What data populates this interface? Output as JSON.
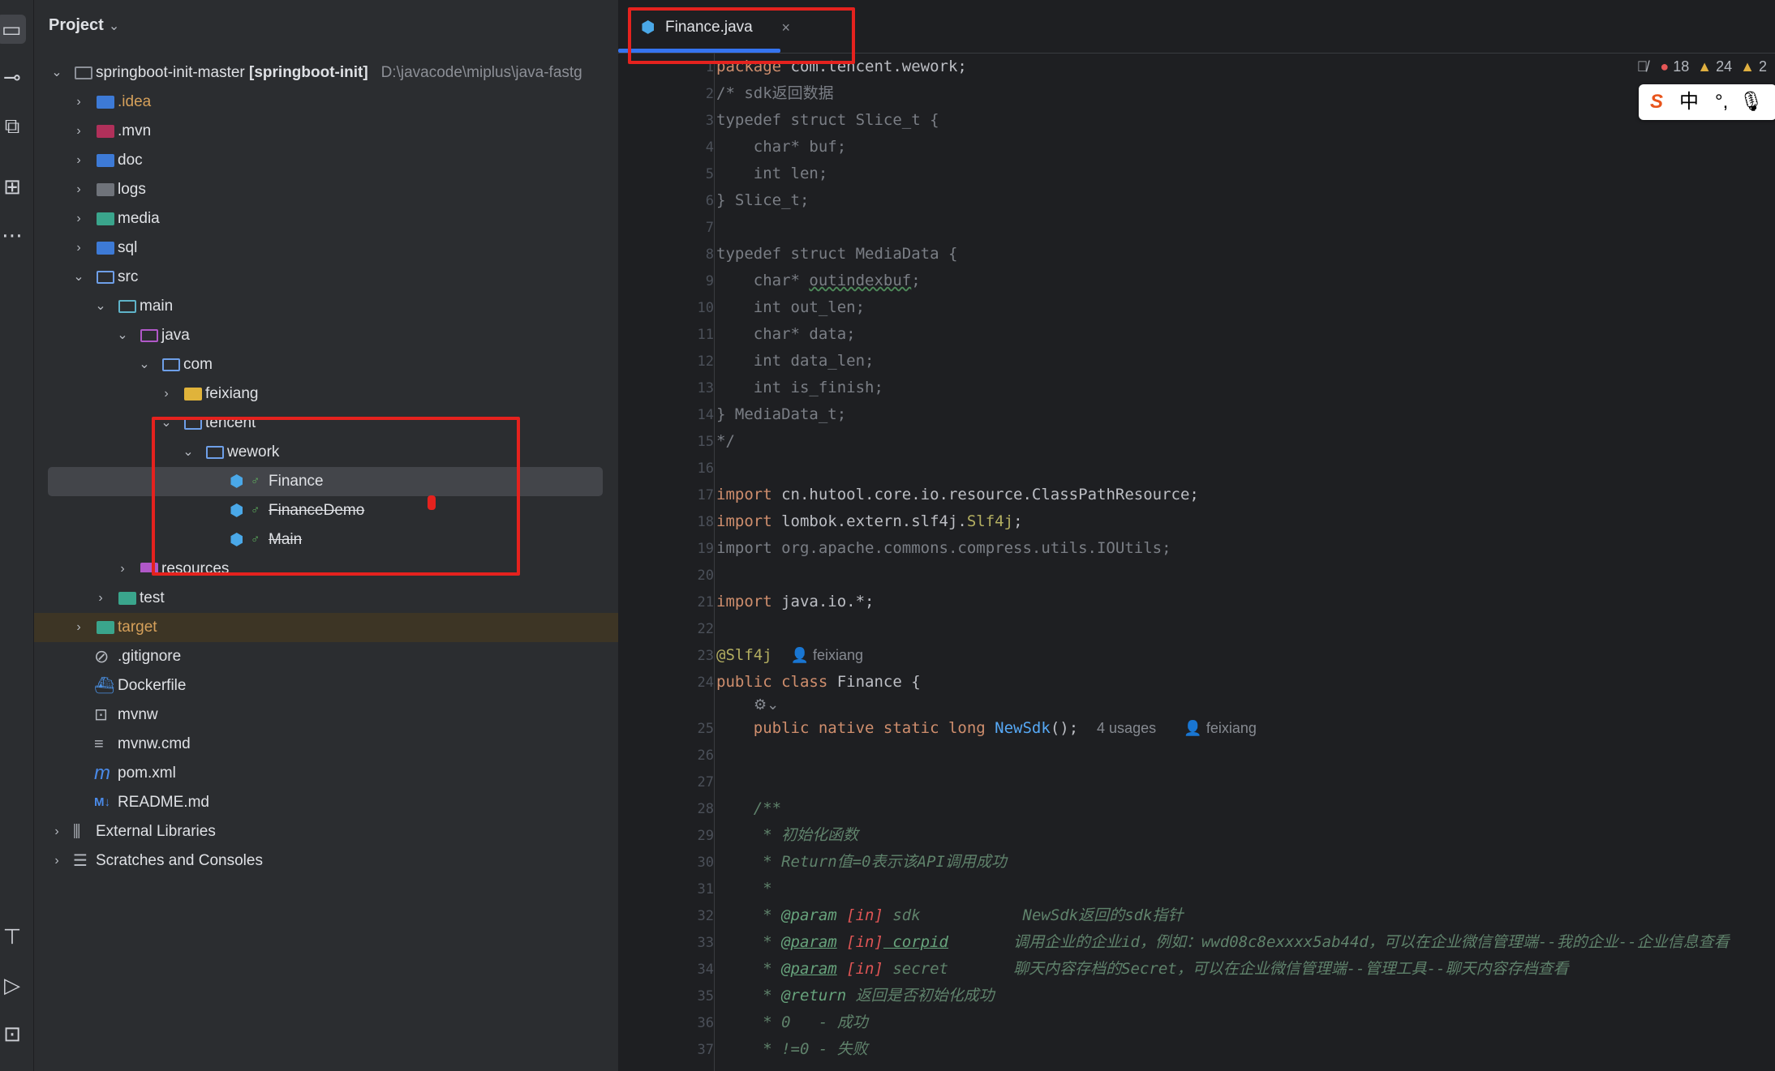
{
  "sidebar": {
    "icons": [
      "folder-icon",
      "commit-icon",
      "vcs-icon",
      "structure-icon",
      "more-icon",
      "build-icon",
      "run-icon",
      "terminal-icon"
    ]
  },
  "project": {
    "title": "Project",
    "tree": [
      {
        "label": "springboot-init-master",
        "bold": "[springboot-init]",
        "path": "D:\\javacode\\miplus\\java-fastg",
        "depth": 0,
        "open": true
      },
      {
        "label": ".idea",
        "depth": 1
      },
      {
        "label": ".mvn",
        "depth": 1
      },
      {
        "label": "doc",
        "depth": 1
      },
      {
        "label": "logs",
        "depth": 1
      },
      {
        "label": "media",
        "depth": 1
      },
      {
        "label": "sql",
        "depth": 1
      },
      {
        "label": "src",
        "depth": 1,
        "open": true
      },
      {
        "label": "main",
        "depth": 2,
        "open": true
      },
      {
        "label": "java",
        "depth": 3,
        "open": true
      },
      {
        "label": "com",
        "depth": 4,
        "open": true
      },
      {
        "label": "feixiang",
        "depth": 5
      },
      {
        "label": "tencent",
        "depth": 4,
        "open": true
      },
      {
        "label": "wework",
        "depth": 5,
        "open": true
      },
      {
        "label": "Finance",
        "depth": 6
      },
      {
        "label": "FinanceDemo",
        "depth": 6
      },
      {
        "label": "Main",
        "depth": 6
      },
      {
        "label": "resources",
        "depth": 3
      },
      {
        "label": "test",
        "depth": 2
      },
      {
        "label": "target",
        "depth": 1
      },
      {
        "label": ".gitignore",
        "depth": 1
      },
      {
        "label": "Dockerfile",
        "depth": 1
      },
      {
        "label": "mvnw",
        "depth": 1
      },
      {
        "label": "mvnw.cmd",
        "depth": 1
      },
      {
        "label": "pom.xml",
        "depth": 1
      },
      {
        "label": "README.md",
        "depth": 1
      },
      {
        "label": "External Libraries",
        "depth": 0
      },
      {
        "label": "Scratches and Consoles",
        "depth": 0
      }
    ]
  },
  "editor": {
    "tab": {
      "label": "Finance.java",
      "close": "×"
    },
    "indicators": {
      "errors": "18",
      "warnings": "24",
      "weak": "2"
    },
    "ime": {
      "logo": "S",
      "lang": "中",
      "punct": "°,",
      "mic": "🎙"
    },
    "hints": {
      "author": "feixiang",
      "usages": "4 usages",
      "author2": "feixiang"
    },
    "lines": [
      "1",
      "2",
      "3",
      "4",
      "5",
      "6",
      "7",
      "8",
      "9",
      "10",
      "11",
      "12",
      "13",
      "14",
      "15",
      "16",
      "17",
      "18",
      "19",
      "20",
      "21",
      "22",
      "23",
      "24",
      "25",
      "26",
      "27",
      "28",
      "29",
      "30",
      "31",
      "32",
      "33",
      "34",
      "35",
      "36",
      "37"
    ],
    "code": {
      "l1a": "package ",
      "l1b": "com.tencent.wework;",
      "l2": "/* sdk返回数据",
      "l3": "typedef struct Slice_t {",
      "l4": "    char* buf;",
      "l5": "    int len;",
      "l6": "} Slice_t;",
      "l8": "typedef struct MediaData {",
      "l9a": "    char* ",
      "l9b": "outindexbuf",
      "l9c": ";",
      "l10": "    int out_len;",
      "l11": "    char* data;",
      "l12": "    int data_len;",
      "l13": "    int is_finish;",
      "l14": "} MediaData_t;",
      "l15": "*/",
      "l17a": "import ",
      "l17b": "cn.hutool.core.io.resource.ClassPathResource;",
      "l18a": "import ",
      "l18b": "lombok.extern.slf4j.",
      "l18c": "Slf4j",
      "l18d": ";",
      "l19": "import org.apache.commons.compress.utils.IOUtils;",
      "l21a": "import ",
      "l21b": "java.io.*;",
      "l23": "@Slf4j",
      "l24a": "public class ",
      "l24b": "Finance {",
      "l25a": "    public native static long ",
      "l25b": "NewSdk",
      "l25c": "();",
      "l28": "    /**",
      "l29": "     * 初始化函数",
      "l30": "     * Return值=0表示该API调用成功",
      "l31": "     *",
      "l32a": "     * ",
      "l32b": "@param",
      "l32c": " [in]",
      "l32d": " sdk",
      "l32e": "           NewSdk返回的sdk指针",
      "l33a": "     * ",
      "l33b": "@param",
      "l33c": " [in]",
      "l33d": " corpid",
      "l33e": "       调用企业的企业id，例如：wwd08c8exxxx5ab44d，可以在企业微信管理端--我的企业--企业信息查看",
      "l34a": "     * ",
      "l34b": "@param",
      "l34c": " [in]",
      "l34d": " secret",
      "l34e": "       聊天内容存档的Secret，可以在企业微信管理端--管理工具--聊天内容存档查看",
      "l35a": "     * ",
      "l35b": "@return",
      "l35c": " 返回是否初始化成功",
      "l36": "     * 0   - 成功",
      "l37": "     * !=0 - 失败"
    }
  },
  "colors": {
    "accent": "#3574f0",
    "annotation_red": "#e5221e",
    "error": "#e55757",
    "warning": "#e0b040"
  }
}
